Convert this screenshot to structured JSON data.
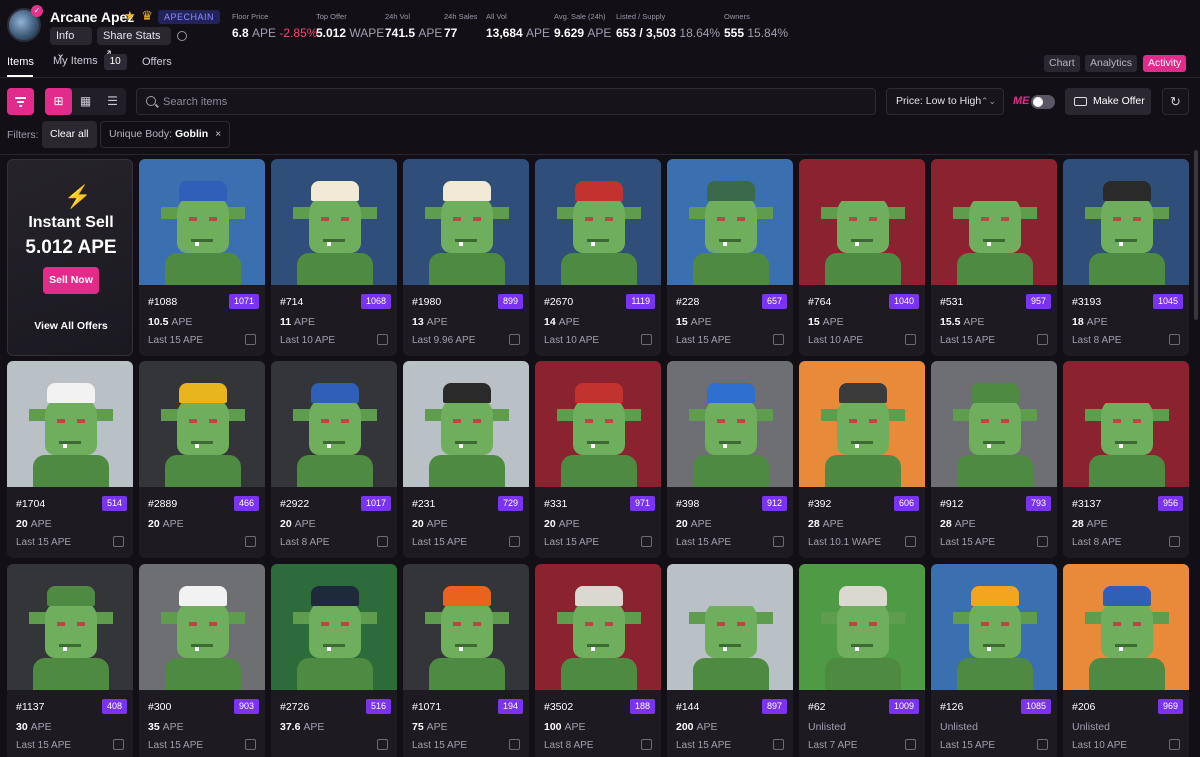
{
  "collection": {
    "name": "Arcane Apez",
    "stars_icon": "star-crown-icons",
    "chain": "APECHAIN",
    "info_label": "Info",
    "share_label": "Share Stats"
  },
  "stats": [
    {
      "label": "Floor Price",
      "value": "6.8",
      "unit": "APE",
      "extra": "-2.85%"
    },
    {
      "label": "Top Offer",
      "value": "5.012",
      "unit": "WAPE",
      "extra": ""
    },
    {
      "label": "24h Vol",
      "value": "741.5",
      "unit": "APE",
      "extra": ""
    },
    {
      "label": "24h Sales",
      "value": "77",
      "unit": "",
      "extra": ""
    },
    {
      "label": "All Vol",
      "value": "13,684",
      "unit": "APE",
      "extra": ""
    },
    {
      "label": "Avg. Sale (24h)",
      "value": "9.629",
      "unit": "APE",
      "extra": ""
    },
    {
      "label": "Listed / Supply",
      "value": "653 / 3,503",
      "unit": "",
      "extra": "18.64%"
    },
    {
      "label": "Owners",
      "value": "555",
      "unit": "",
      "extra": "15.84%"
    }
  ],
  "tabs": {
    "items": "Items",
    "my_items": "My Items",
    "my_items_count": "10",
    "offers": "Offers",
    "chart": "Chart",
    "analytics": "Analytics",
    "activity": "Activity"
  },
  "toolbar": {
    "search_placeholder": "Search items",
    "sort_value": "Price: Low to High",
    "make_offer": "Make Offer"
  },
  "filters": {
    "label": "Filters:",
    "clear_all": "Clear all",
    "chip_key": "Unique Body:",
    "chip_value": "Goblin"
  },
  "instant_sell": {
    "title": "Instant Sell",
    "price": "5.012 APE",
    "button": "Sell Now",
    "link": "View All Offers"
  },
  "colors": {
    "accent": "#e42b8b",
    "rank_badge": "#7a33f0"
  },
  "cards": [
    {
      "id": "#1088",
      "rank": "1071",
      "price": "10.5",
      "cur": "APE",
      "last": "Last 15 APE",
      "bg": "#3a6fb0",
      "hat": "#2f5fb6"
    },
    {
      "id": "#714",
      "rank": "1068",
      "price": "11",
      "cur": "APE",
      "last": "Last 10 APE",
      "bg": "#2f4f7a",
      "hat": "#f2ead6"
    },
    {
      "id": "#1980",
      "rank": "899",
      "price": "13",
      "cur": "APE",
      "last": "Last 9.96 APE",
      "bg": "#2f4f7a",
      "hat": "#f2ead6"
    },
    {
      "id": "#2670",
      "rank": "1119",
      "price": "14",
      "cur": "APE",
      "last": "Last 10 APE",
      "bg": "#2f4f7a",
      "hat": "#c2322e"
    },
    {
      "id": "#228",
      "rank": "657",
      "price": "15",
      "cur": "APE",
      "last": "Last 15 APE",
      "bg": "#3a6fb0",
      "hat": "#3b6a4a"
    },
    {
      "id": "#764",
      "rank": "1040",
      "price": "15",
      "cur": "APE",
      "last": "Last 10 APE",
      "bg": "#8a2230",
      "hat": "#8a2230"
    },
    {
      "id": "#531",
      "rank": "957",
      "price": "15.5",
      "cur": "APE",
      "last": "Last 15 APE",
      "bg": "#8a2230",
      "hat": "#8a2230"
    },
    {
      "id": "#3193",
      "rank": "1045",
      "price": "18",
      "cur": "APE",
      "last": "Last 8 APE",
      "bg": "#2f4f7a",
      "hat": "#2a2a2a"
    },
    {
      "id": "#1704",
      "rank": "514",
      "price": "20",
      "cur": "APE",
      "last": "Last 15 APE",
      "bg": "#b9c0c6",
      "hat": "#f2f2f2"
    },
    {
      "id": "#2889",
      "rank": "466",
      "price": "20",
      "cur": "APE",
      "last": "",
      "bg": "#333538",
      "hat": "#e9b51f"
    },
    {
      "id": "#2922",
      "rank": "1017",
      "price": "20",
      "cur": "APE",
      "last": "Last 8 APE",
      "bg": "#333538",
      "hat": "#2f5fb6"
    },
    {
      "id": "#231",
      "rank": "729",
      "price": "20",
      "cur": "APE",
      "last": "Last 15 APE",
      "bg": "#b9c0c6",
      "hat": "#2a2a2a"
    },
    {
      "id": "#331",
      "rank": "971",
      "price": "20",
      "cur": "APE",
      "last": "Last 15 APE",
      "bg": "#8a2230",
      "hat": "#c2322e"
    },
    {
      "id": "#398",
      "rank": "912",
      "price": "20",
      "cur": "APE",
      "last": "Last 15 APE",
      "bg": "#6d6f73",
      "hat": "#2f6fd0"
    },
    {
      "id": "#392",
      "rank": "606",
      "price": "28",
      "cur": "APE",
      "last": "Last 10.1 WAPE",
      "bg": "#e98a3a",
      "hat": "#3b3b3b"
    },
    {
      "id": "#912",
      "rank": "793",
      "price": "28",
      "cur": "APE",
      "last": "Last 15 APE",
      "bg": "#6d6f73",
      "hat": "#4f8a42"
    },
    {
      "id": "#3137",
      "rank": "956",
      "price": "28",
      "cur": "APE",
      "last": "Last 8 APE",
      "bg": "#8a2230",
      "hat": "#8a2230"
    },
    {
      "id": "#1137",
      "rank": "408",
      "price": "30",
      "cur": "APE",
      "last": "Last 15 APE",
      "bg": "#333538",
      "hat": "#4f8a42"
    },
    {
      "id": "#300",
      "rank": "903",
      "price": "35",
      "cur": "APE",
      "last": "Last 15 APE",
      "bg": "#6d6f73",
      "hat": "#f2f2f2"
    },
    {
      "id": "#2726",
      "rank": "516",
      "price": "37.6",
      "cur": "APE",
      "last": "",
      "bg": "#2e6b3a",
      "hat": "#1e2a3a"
    },
    {
      "id": "#1071",
      "rank": "194",
      "price": "75",
      "cur": "APE",
      "last": "Last 15 APE",
      "bg": "#333538",
      "hat": "#e9631f"
    },
    {
      "id": "#3502",
      "rank": "188",
      "price": "100",
      "cur": "APE",
      "last": "Last 8 APE",
      "bg": "#8a2230",
      "hat": "#d9d9cf"
    },
    {
      "id": "#144",
      "rank": "897",
      "price": "200",
      "cur": "APE",
      "last": "Last 15 APE",
      "bg": "#b9c0c6",
      "hat": "#b9c0c6"
    },
    {
      "id": "#62",
      "rank": "1009",
      "price": "Unlisted",
      "cur": "",
      "last": "Last 7 APE",
      "bg": "#4f9a44",
      "hat": "#d9d9cf"
    },
    {
      "id": "#126",
      "rank": "1085",
      "price": "Unlisted",
      "cur": "",
      "last": "Last 15 APE",
      "bg": "#3a6fb0",
      "hat": "#f2a51f"
    },
    {
      "id": "#206",
      "rank": "969",
      "price": "Unlisted",
      "cur": "",
      "last": "Last 10 APE",
      "bg": "#e98a3a",
      "hat": "#2f5fb6"
    }
  ]
}
